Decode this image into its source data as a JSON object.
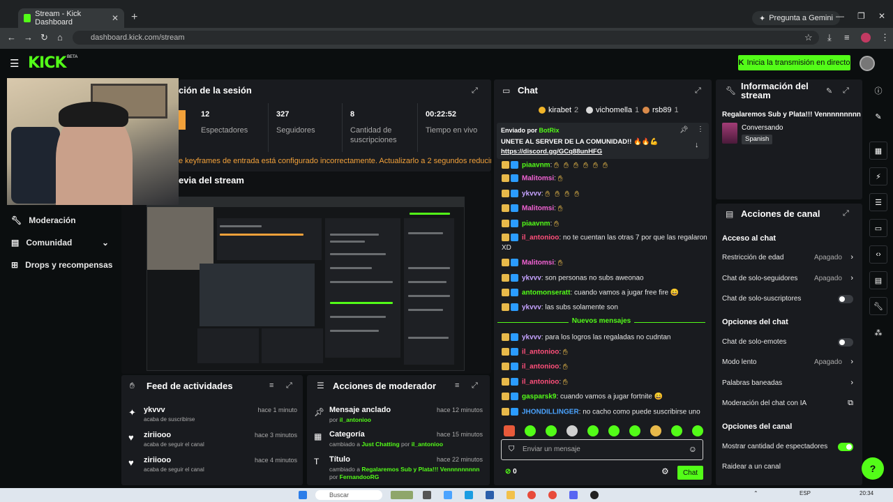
{
  "browser": {
    "tab_title": "Stream - Kick Dashboard",
    "tab_close": "✕",
    "new_tab": "+",
    "gemini_label": "Pregunta a Gemini",
    "url": "dashboard.kick.com/stream"
  },
  "header": {
    "logo": "KICK",
    "beta": "BETA",
    "go_live_label": "Inicia la transmisión en directo"
  },
  "sidebar": {
    "items": [
      {
        "label": "Moderación"
      },
      {
        "label": "Comunidad"
      },
      {
        "label": "Drops y recompensas"
      }
    ]
  },
  "session": {
    "title": "ción de la sesión",
    "stats": [
      {
        "value": "12",
        "label": "Espectadores"
      },
      {
        "value": "327",
        "label": "Seguidores"
      },
      {
        "value": "8",
        "label": "Cantidad de suscripciones"
      },
      {
        "value": "00:22:52",
        "label": "Tiempo en vivo"
      }
    ],
    "warning": "e keyframes de entrada está configurado incorrectamente. Actualizarlo a 2 segundos reducirá la"
  },
  "preview": {
    "title": "evia del stream"
  },
  "activity_feed": {
    "title": "Feed de actividades",
    "items": [
      {
        "name": "ykvvv",
        "sub": "acaba de suscribirse",
        "time": "hace 1 minuto",
        "icon": "sparkle-icon"
      },
      {
        "name": "ziriiooo",
        "sub": "acaba de seguir el canal",
        "time": "hace 3 minutos",
        "icon": "heart-icon"
      },
      {
        "name": "ziriiooo",
        "sub": "acaba de seguir el canal",
        "time": "hace 4 minutos",
        "icon": "heart-icon"
      }
    ]
  },
  "mod_actions": {
    "title": "Acciones de moderador",
    "items": [
      {
        "name": "Mensaje anclado",
        "sub_prefix": "por",
        "sub_user": "il_antonioo",
        "time": "hace 12 minutos"
      },
      {
        "name": "Categoría",
        "sub_prefix": "cambiado a",
        "sub_value": "Just Chatting",
        "sub_mid": "por",
        "sub_user": "il_antonioo",
        "time": "hace 15 minutos"
      },
      {
        "name": "Título",
        "sub_prefix": "cambiado a",
        "sub_value": "Regalaremos Sub y Plata!!! Vennnnnnnnn",
        "sub_mid": "por",
        "sub_user": "FernandooRG",
        "time": "hace 22 minutos"
      }
    ]
  },
  "chat": {
    "title": "Chat",
    "top_users": [
      {
        "rank": "1",
        "name": "kirabet",
        "count": "2",
        "color": "#f0b429"
      },
      {
        "rank": "2",
        "name": "vichomella",
        "count": "1",
        "color": "#d9d9d9"
      },
      {
        "rank": "3",
        "name": "rsb89",
        "count": "1",
        "color": "#d98a4a"
      }
    ],
    "pinned": {
      "by_label": "Enviado por",
      "by_user": "BotRix",
      "message": "UNETE AL SERVER DE LA COMUNIDAD!! 🔥🔥💪",
      "link": "https://discord.gg/GCq88unHFG"
    },
    "messages": [
      {
        "user": "piaavnm",
        "color": "#53fc18",
        "text": "",
        "emotes": 6
      },
      {
        "user": "Malitomsi",
        "color": "#f263d4",
        "text": "",
        "emotes": 1
      },
      {
        "user": "ykvvv",
        "color": "#c6a3ff",
        "text": "",
        "emotes": 4
      },
      {
        "user": "Malitomsi",
        "color": "#f263d4",
        "text": "",
        "emotes": 1
      },
      {
        "user": "piaavnm",
        "color": "#53fc18",
        "text": "",
        "emotes": 1
      },
      {
        "user": "il_antonioo",
        "color": "#ff4f7a",
        "text": "no te cuentan las otras 7 por que las regalaron XD",
        "emotes": 0
      },
      {
        "user": "Malitomsi",
        "color": "#f263d4",
        "text": "",
        "emotes": 1
      },
      {
        "user": "ykvvv",
        "color": "#c6a3ff",
        "text": "son personas no subs aweonao",
        "emotes": 0
      },
      {
        "user": "antomonseratt",
        "color": "#53fc18",
        "text": "cuando vamos a jugar free fire 😄",
        "emotes": 0
      },
      {
        "user": "ykvvv",
        "color": "#c6a3ff",
        "text": "las subs solamente son",
        "emotes": 0
      }
    ],
    "new_messages_label": "Nuevos mensajes",
    "new_messages": [
      {
        "user": "ykvvv",
        "color": "#c6a3ff",
        "text": "para los logros las regaladas no cudntan",
        "emotes": 0
      },
      {
        "user": "il_antonioo",
        "color": "#ff4f7a",
        "text": "",
        "emotes": 1
      },
      {
        "user": "il_antonioo",
        "color": "#ff4f7a",
        "text": "",
        "emotes": 1
      },
      {
        "user": "il_antonioo",
        "color": "#ff4f7a",
        "text": "",
        "emotes": 1
      },
      {
        "user": "gasparsk9",
        "color": "#53fc18",
        "text": "cuando vamos a jugar fortnite 😄",
        "emotes": 0
      },
      {
        "user": "JHONDILLINGER",
        "color": "#4aa3ff",
        "text": "no cacho como puede suscribirse uno",
        "emotes": 0
      }
    ],
    "input_placeholder": "Enviar un mensaje",
    "points": "0",
    "send_label": "Chat"
  },
  "stream_info": {
    "title": "Información del stream",
    "stream_title": "Regalaremos Sub y Plata!!! Vennnnnnnnn",
    "category": "Conversando",
    "language": "Spanish"
  },
  "channel_actions": {
    "title": "Acciones de canal",
    "sections": [
      {
        "heading": "Acceso al chat"
      },
      {
        "heading": "Opciones del chat"
      },
      {
        "heading": "Opciones del canal"
      }
    ],
    "rows": [
      {
        "label": "Restricción de edad",
        "value": "Apagado",
        "type": "chevron"
      },
      {
        "label": "Chat de solo-seguidores",
        "value": "Apagado",
        "type": "chevron"
      },
      {
        "label": "Chat de solo-suscriptores",
        "value": "",
        "type": "toggle-off"
      },
      {
        "label": "Chat de solo-emotes",
        "value": "",
        "type": "toggle-off"
      },
      {
        "label": "Modo lento",
        "value": "Apagado",
        "type": "chevron"
      },
      {
        "label": "Palabras baneadas",
        "value": "",
        "type": "chevron"
      },
      {
        "label": "Moderación del chat con IA",
        "value": "",
        "type": "external"
      },
      {
        "label": "Mostrar cantidad de espectadores",
        "value": "",
        "type": "toggle-on"
      },
      {
        "label": "Raidear a un canal",
        "value": "",
        "type": "none"
      }
    ]
  },
  "taskbar": {
    "search_label": "Buscar",
    "lang": "ESP",
    "time": "20:34"
  }
}
